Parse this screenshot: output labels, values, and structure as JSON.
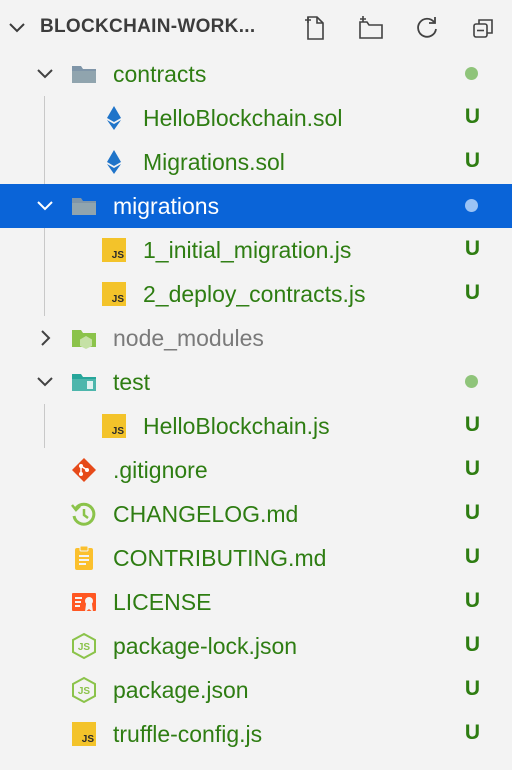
{
  "explorer": {
    "title": "BLOCKCHAIN-WORK...",
    "actions": [
      "new-file-icon",
      "new-folder-icon",
      "refresh-icon",
      "collapse-all-icon"
    ]
  },
  "colors": {
    "untracked_green": "#2e7d12",
    "selection_blue": "#0a64d8",
    "dot_green": "#8fc47a",
    "js_yellow": "#f3c32a",
    "ethereum_blue": "#1f74c9"
  },
  "tree": [
    {
      "label": "contracts",
      "icon": "folder-icon",
      "twisty": "expanded",
      "status": "dot"
    },
    {
      "label": "HelloBlockchain.sol",
      "icon": "ethereum-icon",
      "status": "U"
    },
    {
      "label": "Migrations.sol",
      "icon": "ethereum-icon",
      "status": "U"
    },
    {
      "label": "migrations",
      "icon": "folder-icon",
      "twisty": "expanded",
      "status": "dot",
      "selected": true
    },
    {
      "label": "1_initial_migration.js",
      "icon": "js-file-icon",
      "status": "U"
    },
    {
      "label": "2_deploy_contracts.js",
      "icon": "js-file-icon",
      "status": "U"
    },
    {
      "label": "node_modules",
      "icon": "node-folder-icon",
      "twisty": "collapsed",
      "dim": true
    },
    {
      "label": "test",
      "icon": "test-folder-icon",
      "twisty": "expanded",
      "status": "dot"
    },
    {
      "label": "HelloBlockchain.js",
      "icon": "js-file-icon",
      "status": "U"
    },
    {
      "label": ".gitignore",
      "icon": "git-icon",
      "status": "U"
    },
    {
      "label": "CHANGELOG.md",
      "icon": "changelog-icon",
      "status": "U"
    },
    {
      "label": "CONTRIBUTING.md",
      "icon": "contributing-icon",
      "status": "U"
    },
    {
      "label": "LICENSE",
      "icon": "license-icon",
      "status": "U"
    },
    {
      "label": "package-lock.json",
      "icon": "nodejs-icon",
      "status": "U"
    },
    {
      "label": "package.json",
      "icon": "nodejs-icon",
      "status": "U"
    },
    {
      "label": "truffle-config.js",
      "icon": "js-file-icon",
      "status": "U"
    }
  ],
  "js_badge_text": "JS"
}
